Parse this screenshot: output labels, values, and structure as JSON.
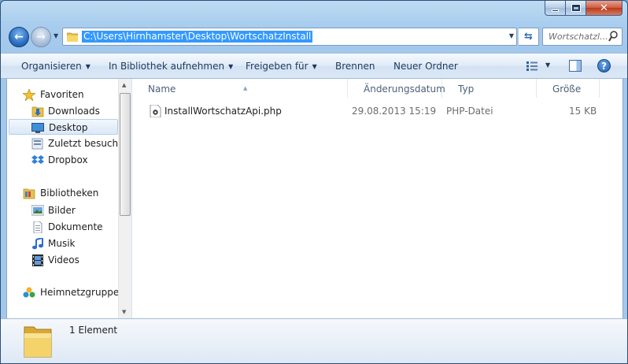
{
  "address": {
    "path": "C:\\Users\\Hirnhamster\\Desktop\\WortschatzInstall"
  },
  "search": {
    "placeholder": "Wortschatzl..."
  },
  "toolbar": {
    "organize": "Organisieren",
    "include_library": "In Bibliothek aufnehmen",
    "share": "Freigeben für",
    "burn": "Brennen",
    "new_folder": "Neuer Ordner"
  },
  "sidebar": {
    "favorites": {
      "title": "Favoriten",
      "items": [
        "Downloads",
        "Desktop",
        "Zuletzt besucht",
        "Dropbox"
      ],
      "selected": "Desktop"
    },
    "libraries": {
      "title": "Bibliotheken",
      "items": [
        "Bilder",
        "Dokumente",
        "Musik",
        "Videos"
      ]
    },
    "homegroup": "Heimnetzgruppe"
  },
  "columns": {
    "name": "Name",
    "modified": "Änderungsdatum",
    "type": "Typ",
    "size": "Größe"
  },
  "files": [
    {
      "name": "InstallWortschatzApi.php",
      "modified": "29.08.2013 15:19",
      "type": "PHP-Datei",
      "size": "15 KB"
    }
  ],
  "details": {
    "count": "1 Element"
  },
  "colors": {
    "selection": "#3399ff",
    "close_button": "#c8482a",
    "frame": "#a9cdee"
  }
}
